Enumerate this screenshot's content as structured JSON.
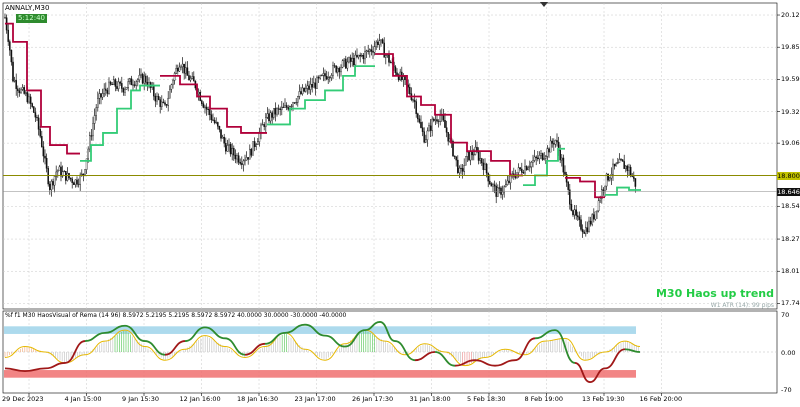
{
  "symbol_title": "ANNALY,M30",
  "badge": "5:12:40",
  "price_axis": [
    "20.121",
    "19.856",
    "19.591",
    "19.326",
    "19.066",
    "18.800",
    "18.546",
    "18.276",
    "18.011",
    "17.746"
  ],
  "current_prices": {
    "level_line": "18.800",
    "bid": "18.646"
  },
  "time_axis": [
    "29 Dec 2023",
    "4 Jan 15:00",
    "9 Jan 15:30",
    "12 Jan 16:00",
    "18 Jan 16:30",
    "23 Jan 17:00",
    "26 Jan 17:30",
    "31 Jan 18:00",
    "5 Feb 18:30",
    "8 Feb 19:00",
    "13 Feb 19:30",
    "16 Feb 20:00"
  ],
  "trend_label": "M30 Haos up trend",
  "atr_label": "W1 ATR (14): 99 pips",
  "indicator": {
    "title": "%f f1 M30 HaosVisual of Rema (14 96) 8.5972 5.2195 5.2195 8.5972 8.5972 40.0000 30.0000 -30.0000 -40.0000",
    "axis": [
      "70",
      "0.00",
      "-70"
    ]
  },
  "colors": {
    "candle": "#111111",
    "trend_down": "#b0003a",
    "trend_up": "#33cc77",
    "level_line": "#8b8b00",
    "upper_band": "#9fd4ea",
    "lower_band": "#f07070",
    "osc_yellow": "#e6b800",
    "osc_green": "#2e8b2e",
    "osc_red": "#a01818",
    "trend_label": "#22cc44"
  },
  "chart_data": {
    "type": "candlestick",
    "ylim": [
      17.7,
      20.22
    ],
    "indicator_ylim": [
      -75,
      75
    ],
    "level": 18.8,
    "bid": 18.646,
    "y_ticks": [
      20.121,
      19.856,
      19.591,
      19.326,
      19.066,
      18.8,
      18.546,
      18.276,
      18.011,
      17.746
    ],
    "path_anchors": [
      [
        0,
        20.1
      ],
      [
        4,
        19.9
      ],
      [
        8,
        19.6
      ],
      [
        15,
        19.5
      ],
      [
        22,
        19.45
      ],
      [
        30,
        19.3
      ],
      [
        36,
        19.1
      ],
      [
        40,
        18.9
      ],
      [
        45,
        18.7
      ],
      [
        52,
        18.85
      ],
      [
        60,
        18.8
      ],
      [
        70,
        18.75
      ],
      [
        78,
        18.8
      ],
      [
        85,
        19.1
      ],
      [
        92,
        19.4
      ],
      [
        100,
        19.5
      ],
      [
        108,
        19.55
      ],
      [
        118,
        19.52
      ],
      [
        128,
        19.58
      ],
      [
        140,
        19.6
      ],
      [
        150,
        19.45
      ],
      [
        160,
        19.35
      ],
      [
        168,
        19.6
      ],
      [
        175,
        19.75
      ],
      [
        182,
        19.62
      ],
      [
        190,
        19.55
      ],
      [
        198,
        19.4
      ],
      [
        205,
        19.3
      ],
      [
        212,
        19.2
      ],
      [
        220,
        19.05
      ],
      [
        228,
        18.98
      ],
      [
        236,
        18.93
      ],
      [
        244,
        18.97
      ],
      [
        252,
        19.1
      ],
      [
        260,
        19.25
      ],
      [
        270,
        19.32
      ],
      [
        280,
        19.35
      ],
      [
        290,
        19.43
      ],
      [
        300,
        19.5
      ],
      [
        310,
        19.55
      ],
      [
        320,
        19.62
      ],
      [
        330,
        19.68
      ],
      [
        340,
        19.72
      ],
      [
        350,
        19.75
      ],
      [
        360,
        19.8
      ],
      [
        368,
        19.85
      ],
      [
        374,
        19.92
      ],
      [
        380,
        19.8
      ],
      [
        388,
        19.7
      ],
      [
        396,
        19.6
      ],
      [
        404,
        19.5
      ],
      [
        410,
        19.4
      ],
      [
        415,
        19.2
      ],
      [
        420,
        19.1
      ],
      [
        428,
        19.25
      ],
      [
        435,
        19.3
      ],
      [
        442,
        19.15
      ],
      [
        448,
        19.0
      ],
      [
        455,
        18.8
      ],
      [
        462,
        18.95
      ],
      [
        470,
        19.0
      ],
      [
        478,
        18.9
      ],
      [
        485,
        18.75
      ],
      [
        492,
        18.65
      ],
      [
        500,
        18.7
      ],
      [
        508,
        18.8
      ],
      [
        516,
        18.85
      ],
      [
        525,
        18.9
      ],
      [
        535,
        18.95
      ],
      [
        542,
        19.0
      ],
      [
        550,
        19.1
      ],
      [
        556,
        18.95
      ],
      [
        562,
        18.7
      ],
      [
        568,
        18.5
      ],
      [
        574,
        18.4
      ],
      [
        580,
        18.35
      ],
      [
        588,
        18.45
      ],
      [
        594,
        18.6
      ],
      [
        600,
        18.75
      ],
      [
        608,
        18.85
      ],
      [
        616,
        18.9
      ],
      [
        624,
        18.85
      ],
      [
        632,
        18.7
      ]
    ],
    "trend_segments": [
      {
        "side": "down",
        "points": [
          [
            0,
            20.05
          ],
          [
            8,
            20.05
          ],
          [
            8,
            19.9
          ],
          [
            22,
            19.9
          ],
          [
            22,
            19.5
          ],
          [
            36,
            19.5
          ],
          [
            36,
            19.2
          ],
          [
            45,
            19.2
          ],
          [
            45,
            19.05
          ],
          [
            62,
            19.05
          ],
          [
            62,
            18.98
          ],
          [
            75,
            18.98
          ]
        ]
      },
      {
        "side": "up",
        "points": [
          [
            75,
            18.92
          ],
          [
            86,
            18.92
          ],
          [
            86,
            19.05
          ],
          [
            98,
            19.05
          ],
          [
            98,
            19.15
          ],
          [
            112,
            19.15
          ],
          [
            112,
            19.35
          ],
          [
            126,
            19.35
          ],
          [
            126,
            19.5
          ],
          [
            135,
            19.5
          ],
          [
            135,
            19.54
          ],
          [
            155,
            19.54
          ]
        ]
      },
      {
        "side": "down",
        "points": [
          [
            155,
            19.62
          ],
          [
            175,
            19.62
          ],
          [
            175,
            19.55
          ],
          [
            192,
            19.55
          ],
          [
            192,
            19.45
          ],
          [
            205,
            19.45
          ],
          [
            205,
            19.35
          ],
          [
            222,
            19.35
          ],
          [
            222,
            19.2
          ],
          [
            236,
            19.2
          ],
          [
            236,
            19.15
          ],
          [
            262,
            19.15
          ]
        ]
      },
      {
        "side": "up",
        "points": [
          [
            262,
            19.22
          ],
          [
            285,
            19.22
          ],
          [
            285,
            19.35
          ],
          [
            300,
            19.35
          ],
          [
            300,
            19.42
          ],
          [
            320,
            19.42
          ],
          [
            320,
            19.5
          ],
          [
            338,
            19.5
          ],
          [
            338,
            19.62
          ],
          [
            350,
            19.62
          ],
          [
            350,
            19.7
          ],
          [
            370,
            19.7
          ]
        ]
      },
      {
        "side": "down",
        "points": [
          [
            370,
            19.8
          ],
          [
            388,
            19.8
          ],
          [
            388,
            19.62
          ],
          [
            402,
            19.62
          ],
          [
            402,
            19.45
          ],
          [
            416,
            19.45
          ],
          [
            416,
            19.38
          ],
          [
            430,
            19.38
          ],
          [
            430,
            19.3
          ],
          [
            446,
            19.3
          ],
          [
            446,
            19.07
          ],
          [
            462,
            19.07
          ],
          [
            462,
            19.0
          ],
          [
            486,
            19.0
          ],
          [
            486,
            18.92
          ],
          [
            505,
            18.92
          ],
          [
            505,
            18.8
          ],
          [
            518,
            18.8
          ]
        ]
      },
      {
        "side": "up",
        "points": [
          [
            518,
            18.72
          ],
          [
            530,
            18.72
          ],
          [
            530,
            18.8
          ],
          [
            542,
            18.8
          ],
          [
            542,
            18.92
          ],
          [
            553,
            18.92
          ],
          [
            553,
            19.02
          ],
          [
            560,
            19.02
          ]
        ]
      },
      {
        "side": "down",
        "points": [
          [
            560,
            18.78
          ],
          [
            575,
            18.78
          ],
          [
            575,
            18.75
          ],
          [
            590,
            18.75
          ],
          [
            590,
            18.62
          ],
          [
            600,
            18.62
          ]
        ]
      },
      {
        "side": "up",
        "points": [
          [
            600,
            18.64
          ],
          [
            612,
            18.64
          ],
          [
            612,
            18.7
          ],
          [
            624,
            18.7
          ],
          [
            624,
            18.68
          ],
          [
            636,
            18.68
          ]
        ]
      }
    ],
    "indicator_series": {
      "yellow": [
        [
          0,
          -10
        ],
        [
          20,
          10
        ],
        [
          40,
          0
        ],
        [
          60,
          -20
        ],
        [
          80,
          -5
        ],
        [
          100,
          20
        ],
        [
          120,
          40
        ],
        [
          140,
          10
        ],
        [
          160,
          -15
        ],
        [
          180,
          5
        ],
        [
          200,
          30
        ],
        [
          220,
          10
        ],
        [
          240,
          -10
        ],
        [
          260,
          10
        ],
        [
          280,
          35
        ],
        [
          300,
          5
        ],
        [
          320,
          -15
        ],
        [
          340,
          15
        ],
        [
          360,
          40
        ],
        [
          380,
          20
        ],
        [
          400,
          -5
        ],
        [
          420,
          15
        ],
        [
          440,
          0
        ],
        [
          460,
          -25
        ],
        [
          480,
          -10
        ],
        [
          500,
          5
        ],
        [
          520,
          -5
        ],
        [
          540,
          20
        ],
        [
          560,
          25
        ],
        [
          580,
          -15
        ],
        [
          600,
          0
        ],
        [
          620,
          20
        ],
        [
          635,
          10
        ]
      ],
      "green_red": [
        [
          0,
          -30
        ],
        [
          20,
          -35
        ],
        [
          40,
          -30
        ],
        [
          60,
          -20
        ],
        [
          80,
          20
        ],
        [
          100,
          35
        ],
        [
          120,
          48
        ],
        [
          140,
          20
        ],
        [
          160,
          -5
        ],
        [
          180,
          20
        ],
        [
          200,
          45
        ],
        [
          220,
          25
        ],
        [
          240,
          -5
        ],
        [
          260,
          15
        ],
        [
          280,
          35
        ],
        [
          300,
          50
        ],
        [
          320,
          30
        ],
        [
          340,
          10
        ],
        [
          360,
          40
        ],
        [
          375,
          55
        ],
        [
          390,
          20
        ],
        [
          410,
          -15
        ],
        [
          430,
          0
        ],
        [
          450,
          -25
        ],
        [
          470,
          -15
        ],
        [
          490,
          -25
        ],
        [
          510,
          -15
        ],
        [
          530,
          25
        ],
        [
          550,
          40
        ],
        [
          570,
          -20
        ],
        [
          585,
          -55
        ],
        [
          600,
          -30
        ],
        [
          620,
          5
        ],
        [
          635,
          0
        ]
      ]
    }
  }
}
